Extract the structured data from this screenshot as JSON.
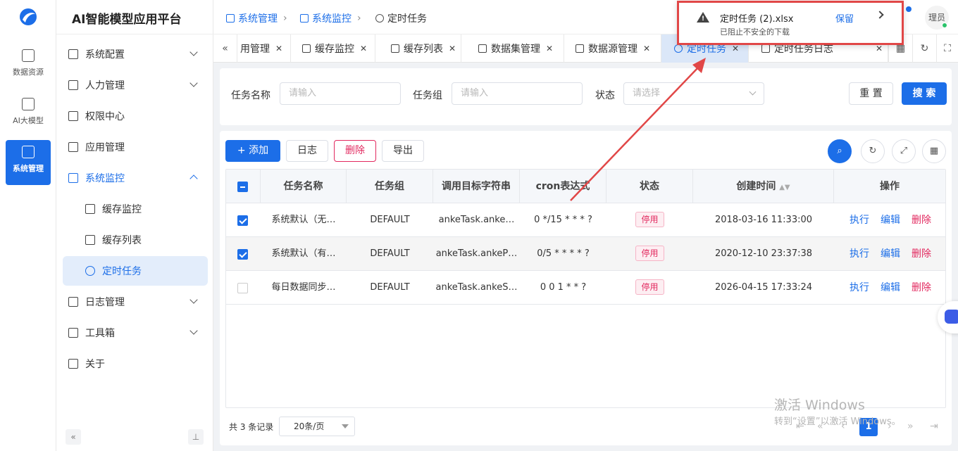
{
  "app": {
    "title": "AI智能模型应用平台"
  },
  "rail": [
    {
      "label": "数据资源",
      "icon": "data-resource-icon",
      "active": false
    },
    {
      "label": "AI大模型",
      "icon": "ai-model-icon",
      "active": false
    },
    {
      "label": "系统管理",
      "icon": "system-manage-icon",
      "active": true
    }
  ],
  "sidebar": [
    {
      "label": "系统配置",
      "icon": "grid-icon",
      "expandable": true
    },
    {
      "label": "人力管理",
      "icon": "users-icon",
      "expandable": true
    },
    {
      "label": "权限中心",
      "icon": "lock-icon",
      "expandable": false
    },
    {
      "label": "应用管理",
      "icon": "apps-icon",
      "expandable": false
    },
    {
      "label": "系统监控",
      "icon": "monitor-icon",
      "expandable": true,
      "open": true
    },
    {
      "label": "缓存监控",
      "icon": "layers-icon",
      "sub": true
    },
    {
      "label": "缓存列表",
      "icon": "doc-icon",
      "sub": true
    },
    {
      "label": "定时任务",
      "icon": "timer-icon",
      "sub": true,
      "active": true
    },
    {
      "label": "日志管理",
      "icon": "log-icon",
      "expandable": true
    },
    {
      "label": "工具箱",
      "icon": "tools-icon",
      "expandable": true
    },
    {
      "label": "关于",
      "icon": "about-icon",
      "expandable": false
    }
  ],
  "breadcrumb": [
    "系统管理",
    "系统监控",
    "定时任务"
  ],
  "tabs": [
    {
      "label": "用管理",
      "icon": "apps-icon"
    },
    {
      "label": "缓存监控",
      "icon": "layers-icon"
    },
    {
      "label": "缓存列表",
      "icon": "doc-icon"
    },
    {
      "label": "数据集管理",
      "icon": "dataset-icon"
    },
    {
      "label": "数据源管理",
      "icon": "datasource-icon"
    },
    {
      "label": "定时任务",
      "icon": "timer-icon",
      "active": true
    },
    {
      "label": "定时任务日志",
      "icon": "log-icon"
    }
  ],
  "search": {
    "name_label": "任务名称",
    "name_placeholder": "请输入",
    "group_label": "任务组",
    "group_placeholder": "请输入",
    "status_label": "状态",
    "status_placeholder": "请选择",
    "reset": "重 置",
    "submit": "搜 索"
  },
  "toolbar": {
    "add": "+ 添加",
    "log": "日志",
    "delete": "删除",
    "export": "导出"
  },
  "table": {
    "columns": [
      "任务名称",
      "任务组",
      "调用目标字符串",
      "cron表达式",
      "状态",
      "创建时间",
      "操作"
    ],
    "rows": [
      {
        "checked": true,
        "name": "系统默认（无…",
        "group": "DEFAULT",
        "target": "ankeTask.anke…",
        "cron": "0 */15 * * * ?",
        "status": "停用",
        "created": "2018-03-16 11:33:00"
      },
      {
        "checked": true,
        "name": "系统默认（有…",
        "group": "DEFAULT",
        "target": "ankeTask.ankeP…",
        "cron": "0/5 * * * * ?",
        "status": "停用",
        "created": "2020-12-10 23:37:38"
      },
      {
        "checked": false,
        "name": "每日数据同步…",
        "group": "DEFAULT",
        "target": "ankeTask.ankeS…",
        "cron": "0 0 1 * * ?",
        "status": "停用",
        "created": "2026-04-15 17:33:24"
      }
    ],
    "actions": {
      "run": "执行",
      "edit": "编辑",
      "delete": "删除"
    }
  },
  "pager": {
    "total": "共 3 条记录",
    "page_size": "20条/页",
    "current": "1"
  },
  "download": {
    "file": "定时任务 (2).xlsx",
    "status": "已阻止不安全的下载",
    "keep": "保留"
  },
  "user": {
    "avatar_text": "理员"
  },
  "watermark": {
    "line1": "激活 Windows",
    "line2": "转到“设置”以激活 Windows。"
  },
  "colors": {
    "primary": "#1c6ee8",
    "danger": "#e2295f",
    "highlight": "#e14747"
  }
}
